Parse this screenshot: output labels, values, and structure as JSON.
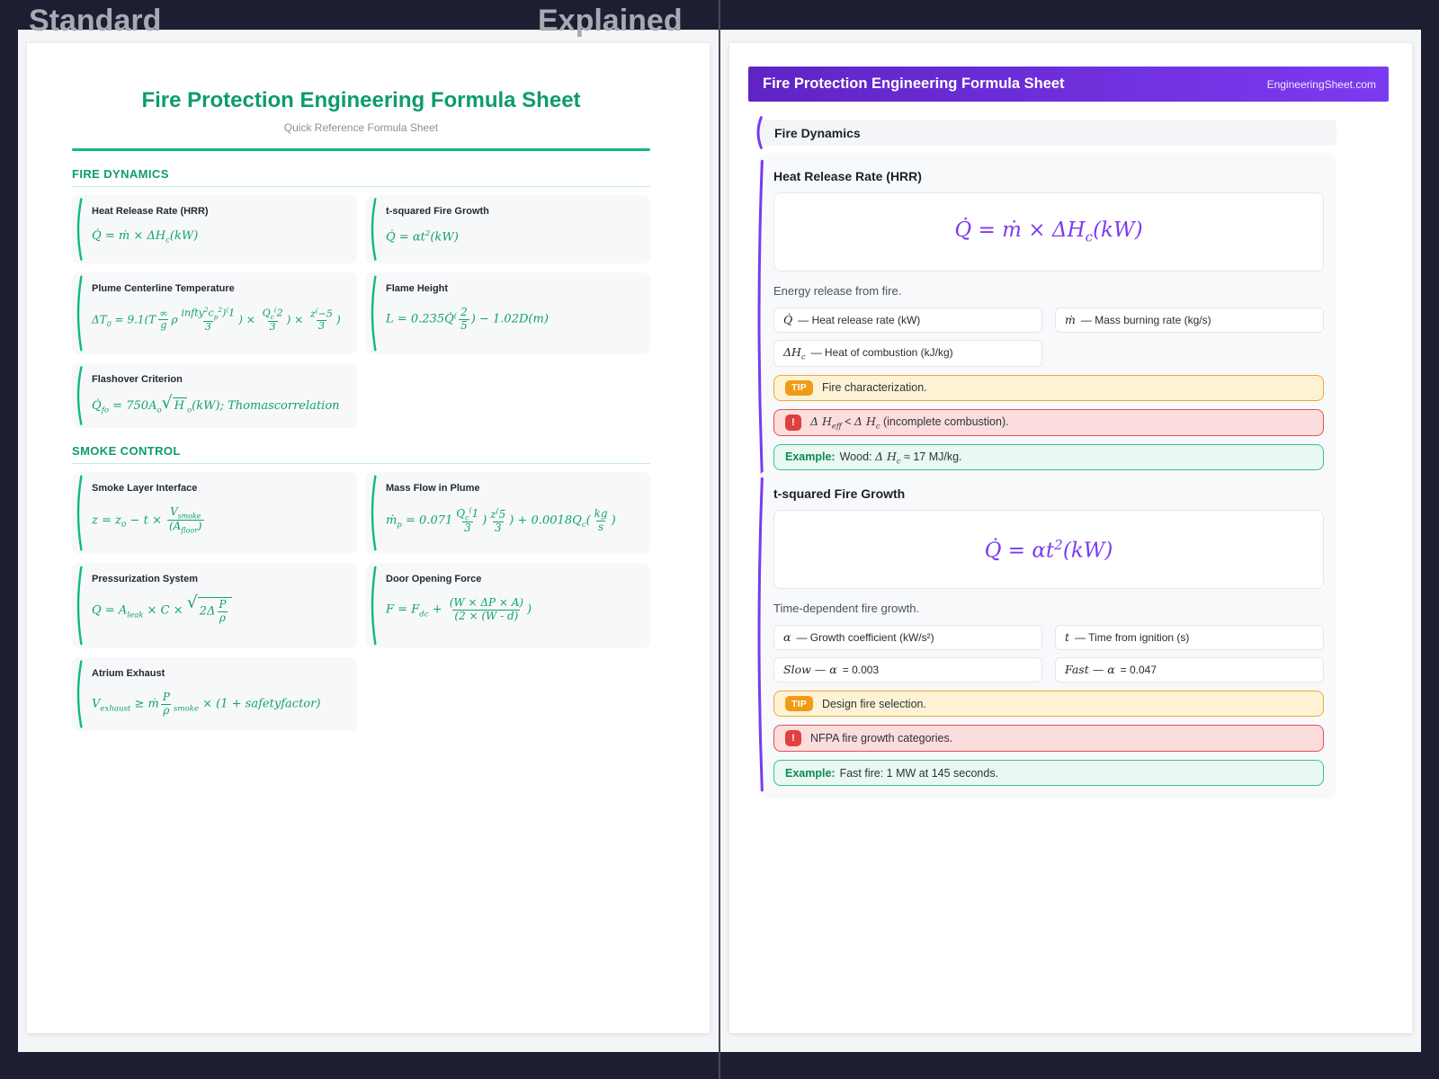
{
  "colors": {
    "page_bg": "#1e1e32",
    "brand_green": "#0c9d68",
    "accent_green": "#10b981",
    "formula_green": "#0fa26f",
    "brand_purple": "#7c3aed",
    "header_purple_dark": "#5f24c4",
    "tip_orange": "#f09b16",
    "tip_orange_border": "#f0a832",
    "warning_red": "#e04040",
    "warning_red_border": "#e05353",
    "example_green": "#38c28d"
  },
  "overlay": {
    "left_label": "Standard",
    "right_label": "Explained"
  },
  "left_page": {
    "title": "Fire Protection Engineering Formula Sheet",
    "subtitle": "Quick Reference Formula Sheet",
    "sections": [
      {
        "heading": "FIRE DYNAMICS",
        "cards": [
          {
            "title": "Heat Release Rate (HRR)",
            "formula": "Q̇ = ṁ × ΔH_{c}(kW)"
          },
          {
            "title": "t-squared Fire Growth",
            "formula": "Q̇ = αt^{2}(kW)"
          },
          {
            "title": "Plume Centerline Temperature",
            "formula": "ΔT_{0} = 9.1(T\\f{∞}{g}ρ\\f{infty^{2}c_{p}^{2})^{(}1}{3}) × \\f{Q_{c}^{(}2}{3}) × \\f{z^{(}−5}{3})"
          },
          {
            "title": "Flame Height",
            "formula": "L = 0.235Q̇^{(}\\f{2}{5}) − 1.02D(m)"
          },
          {
            "title": "Flashover Criterion",
            "formula": "Q̇_{fo} = 750A_{o}\\s{H}_{o}(kW); Thomascorrelation"
          }
        ]
      },
      {
        "heading": "SMOKE CONTROL",
        "cards": [
          {
            "title": "Smoke Layer Interface",
            "formula": "z = z_{0} − t × \\f{V_{smoke}}{(A_{floor})}"
          },
          {
            "title": "Mass Flow in Plume",
            "formula": "ṁ_{p} = 0.071\\f{Q_{c}^{(}1}{3})\\f{z^{(}5}{3}) + 0.0018Q_{c}(\\f{kg}{s})"
          },
          {
            "title": "Pressurization System",
            "formula": "Q = A_{leak} × C × \\s{2Δ\\f{P}{ρ}}"
          },
          {
            "title": "Door Opening Force",
            "formula": "F = F_{dc} + \\f{(W × ΔP × A)}{(2 × (W - d)})"
          },
          {
            "title": "Atrium Exhaust",
            "formula": "V_{exhaust} ≥ ṁ\\f{P}{ρ}_{smoke} × (1 + safetyfactor)"
          }
        ]
      }
    ]
  },
  "right_page": {
    "header": {
      "title": "Fire Protection Engineering Formula Sheet",
      "site": "EngineeringSheet.com"
    },
    "section_label": "Fire Dynamics",
    "cards": [
      {
        "title": "Heat Release Rate (HRR)",
        "formula": "Q̇ = ṁ × ΔH_{c}(kW)",
        "description": "Energy release from fire.",
        "variables": [
          {
            "sym": "Q̇",
            "desc": "— Heat release rate (kW)"
          },
          {
            "sym": "ṁ",
            "desc": "— Mass burning rate (kg/s)"
          },
          {
            "sym": "ΔH_{c}",
            "desc": "— Heat of combustion (kJ/kg)"
          }
        ],
        "tip": {
          "badge": "TIP",
          "text": "Fire characterization."
        },
        "warning": {
          "badge": "!",
          "segments": [
            {
              "m": "Δ H_{eff}"
            },
            {
              "t": " < "
            },
            {
              "m": "Δ H_{c}"
            },
            {
              "t": " (incomplete combustion)."
            }
          ]
        },
        "example": {
          "label": "Example:",
          "segments": [
            {
              "t": "Wood: "
            },
            {
              "m": "Δ H_{c}"
            },
            {
              "t": " ≈ 17 MJ/kg."
            }
          ]
        }
      },
      {
        "title": "t-squared Fire Growth",
        "formula": "Q̇ = αt^{2}(kW)",
        "description": "Time-dependent fire growth.",
        "variables": [
          {
            "sym": "α",
            "desc": "— Growth coefficient (kW/s²)"
          },
          {
            "sym": "t",
            "desc": "— Time from ignition (s)"
          },
          {
            "sym": "Slow — α",
            "desc": "= 0.003"
          },
          {
            "sym": "Fast — α",
            "desc": "= 0.047"
          }
        ],
        "tip": {
          "badge": "TIP",
          "text": "Design fire selection."
        },
        "warning": {
          "badge": "!",
          "segments": [
            {
              "t": "NFPA fire growth categories."
            }
          ]
        },
        "example": {
          "label": "Example:",
          "segments": [
            {
              "t": "Fast fire: 1 MW at 145 seconds."
            }
          ]
        }
      }
    ]
  }
}
